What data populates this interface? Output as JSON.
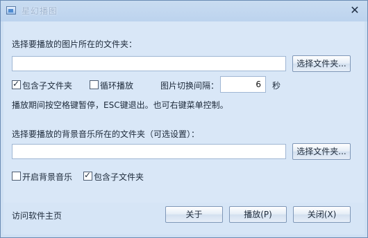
{
  "window": {
    "title": "星幻播图",
    "close_glyph": "✕"
  },
  "image_folder": {
    "label": "选择要播放的图片所在的文件夹：",
    "path_value": "",
    "browse_label": "选择文件夹..."
  },
  "options": {
    "include_subfolders_label": "包含子文件夹",
    "include_subfolders_checked": true,
    "loop_label": "循环播放",
    "loop_checked": false,
    "interval_label": "图片切换间隔：",
    "interval_value": "6",
    "interval_unit": "秒"
  },
  "hint": "播放期间按空格键暂停，ESC键退出。也可右键菜单控制。",
  "music_folder": {
    "label": "选择要播放的背景音乐所在的文件夹（可选设置）：",
    "path_value": "",
    "browse_label": "选择文件夹...",
    "enable_music_label": "开启背景音乐",
    "enable_music_checked": false,
    "include_subfolders_label": "包含子文件夹",
    "include_subfolders_checked": true
  },
  "footer": {
    "homepage_link": "访问软件主页",
    "about_label": "关于",
    "play_label": "播放(P)",
    "close_label": "关闭(X)"
  }
}
